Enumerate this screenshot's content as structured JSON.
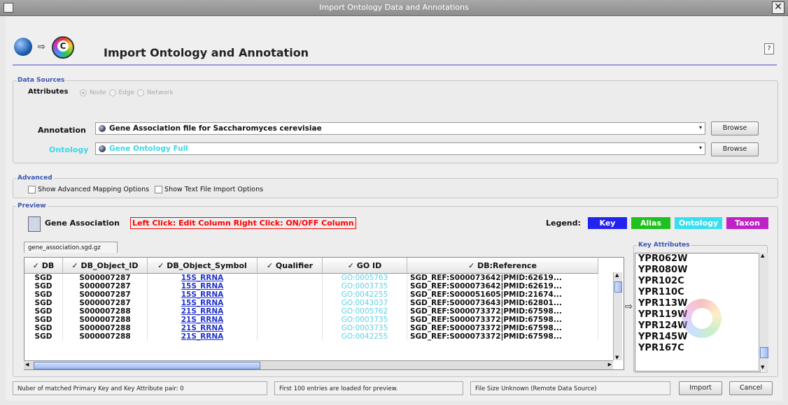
{
  "window": {
    "title": "Import Ontology Data and Annotations",
    "close_glyph": "✕"
  },
  "header": {
    "title": "Import Ontology and Annotation",
    "help": "?",
    "arrow": "⇨"
  },
  "data_sources": {
    "legend": "Data Sources",
    "attributes_label": "Attributes",
    "radio": [
      "Node",
      "Edge",
      "Network"
    ],
    "annotation_label": "Annotation",
    "annotation_value": "Gene Association file for Saccharomyces cerevisiae",
    "ontology_label": "Ontology",
    "ontology_value": "Gene Ontology Full",
    "browse": "Browse",
    "dropdown_glyph": "▾"
  },
  "advanced": {
    "legend": "Advanced",
    "opt1": "Show Advanced Mapping Options",
    "opt2": "Show Text File Import Options"
  },
  "preview": {
    "legend": "Preview",
    "title": "Gene Association",
    "help": "Left Click: Edit Column  Right Click: ON/OFF Column",
    "legend_label": "Legend:",
    "legend_items": [
      {
        "label": "Key",
        "color": "#2323f0"
      },
      {
        "label": "Alias",
        "color": "#20c020"
      },
      {
        "label": "Ontology",
        "color": "#35e0f0"
      },
      {
        "label": "Taxon",
        "color": "#c020c8"
      }
    ],
    "tab": "gene_association.sgd.gz",
    "columns": [
      "✓ DB",
      "✓ DB_Object_ID",
      "✓ DB_Object_Symbol",
      "✓ Qualifier",
      "✓ GO ID",
      "✓ DB:Reference"
    ],
    "rows": [
      [
        "SGD",
        "S000007287",
        "15S_RRNA",
        "",
        "GO:0005763",
        "SGD_REF:S000073642|PMID:62619..."
      ],
      [
        "SGD",
        "S000007287",
        "15S_RRNA",
        "",
        "GO:0003735",
        "SGD_REF:S000073642|PMID:62619..."
      ],
      [
        "SGD",
        "S000007287",
        "15S_RRNA",
        "",
        "GO:0042255",
        "SGD_REF:S000051605|PMID:21674..."
      ],
      [
        "SGD",
        "S000007287",
        "15S_RRNA",
        "",
        "GO:0043037",
        "SGD_REF:S000073643|PMID:62801..."
      ],
      [
        "SGD",
        "S000007288",
        "21S_RRNA",
        "",
        "GO:0005762",
        "SGD_REF:S000073372|PMID:67598..."
      ],
      [
        "SGD",
        "S000007288",
        "21S_RRNA",
        "",
        "GO:0003735",
        "SGD_REF:S000073372|PMID:67598..."
      ],
      [
        "SGD",
        "S000007288",
        "21S_RRNA",
        "",
        "GO:0003735",
        "SGD_REF:S000073372|PMID:67598..."
      ],
      [
        "SGD",
        "S000007288",
        "21S_RRNA",
        "",
        "GO:0042255",
        "SGD_REF:S000073372|PMID:67598..."
      ]
    ],
    "key_attributes_legend": "Key Attributes",
    "key_attributes": [
      "YPR062W",
      "YPR080W",
      "YPR102C",
      "YPR110C",
      "YPR113W",
      "YPR119W",
      "YPR124W",
      "YPR145W",
      "YPR167C"
    ],
    "arrow": "⇨"
  },
  "status": {
    "matched": "Nuber of matched Primary Key and Key Attribute pair: 0",
    "loaded": "First 100 entries are loaded for preview.",
    "filesize": "File Size Unknown (Remote Data Source)"
  },
  "buttons": {
    "import": "Import",
    "cancel": "Cancel"
  }
}
